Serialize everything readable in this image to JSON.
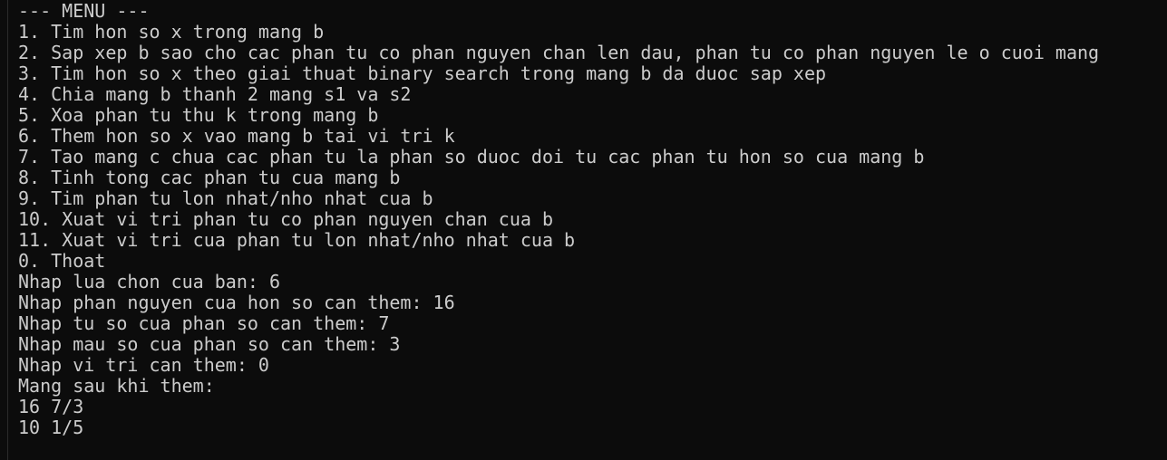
{
  "terminal": {
    "lines": [
      "--- MENU ---",
      "1. Tim hon so x trong mang b",
      "2. Sap xep b sao cho cac phan tu co phan nguyen chan len dau, phan tu co phan nguyen le o cuoi mang",
      "3. Tim hon so x theo giai thuat binary search trong mang b da duoc sap xep",
      "4. Chia mang b thanh 2 mang s1 va s2",
      "5. Xoa phan tu thu k trong mang b",
      "6. Them hon so x vao mang b tai vi tri k",
      "7. Tao mang c chua cac phan tu la phan so duoc doi tu cac phan tu hon so cua mang b",
      "8. Tinh tong cac phan tu cua mang b",
      "9. Tim phan tu lon nhat/nho nhat cua b",
      "10. Xuat vi tri phan tu co phan nguyen chan cua b",
      "11. Xuat vi tri cua phan tu lon nhat/nho nhat cua b",
      "0. Thoat",
      "Nhap lua chon cua ban: 6",
      "Nhap phan nguyen cua hon so can them: 16",
      "Nhap tu so cua phan so can them: 7",
      "Nhap mau so cua phan so can them: 3",
      "Nhap vi tri can them: 0",
      "Mang sau khi them:",
      "16 7/3",
      "10 1/5"
    ]
  },
  "colors": {
    "background": "#0c0c0c",
    "text": "#cccccc"
  }
}
